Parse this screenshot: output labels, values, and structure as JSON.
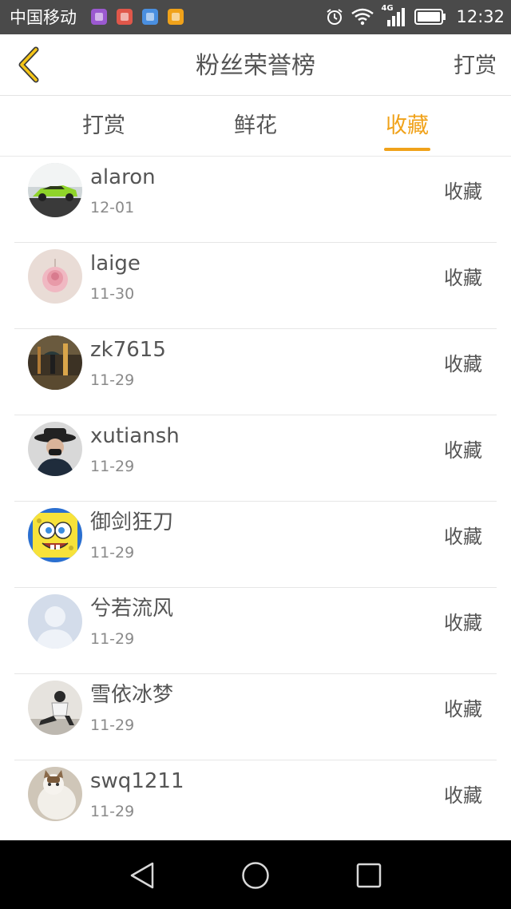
{
  "status_bar": {
    "carrier": "中国移动",
    "network": "4G",
    "time": "12:32",
    "app_icons": [
      {
        "name": "gallery-app-icon",
        "color": "#9b59d0"
      },
      {
        "name": "weibo-app-icon",
        "color": "#e0574a"
      },
      {
        "name": "wifi-app-icon",
        "color": "#4a8fe0"
      },
      {
        "name": "hand-app-icon",
        "color": "#f0a21a"
      }
    ]
  },
  "nav": {
    "title": "粉丝荣誉榜",
    "action": "打赏",
    "accent_color": "#f0a21a"
  },
  "tabs": [
    {
      "label": "打赏",
      "active": false
    },
    {
      "label": "鲜花",
      "active": false
    },
    {
      "label": "收藏",
      "active": true
    }
  ],
  "list": [
    {
      "name": "alaron",
      "date": "12-01",
      "action": "收藏",
      "avatar": "car-avatar"
    },
    {
      "name": "laige",
      "date": "11-30",
      "action": "收藏",
      "avatar": "rose-avatar"
    },
    {
      "name": "zk7615",
      "date": "11-29",
      "action": "收藏",
      "avatar": "rain-street-avatar"
    },
    {
      "name": "xutiansh",
      "date": "11-29",
      "action": "收藏",
      "avatar": "man-hat-avatar"
    },
    {
      "name": "御剑狂刀",
      "date": "11-29",
      "action": "收藏",
      "avatar": "spongebob-avatar"
    },
    {
      "name": "兮若流风",
      "date": "11-29",
      "action": "收藏",
      "avatar": "default-person-avatar"
    },
    {
      "name": "雪依冰梦",
      "date": "11-29",
      "action": "收藏",
      "avatar": "sitting-person-avatar"
    },
    {
      "name": "swq1211",
      "date": "11-29",
      "action": "收藏",
      "avatar": "cat-avatar"
    }
  ]
}
